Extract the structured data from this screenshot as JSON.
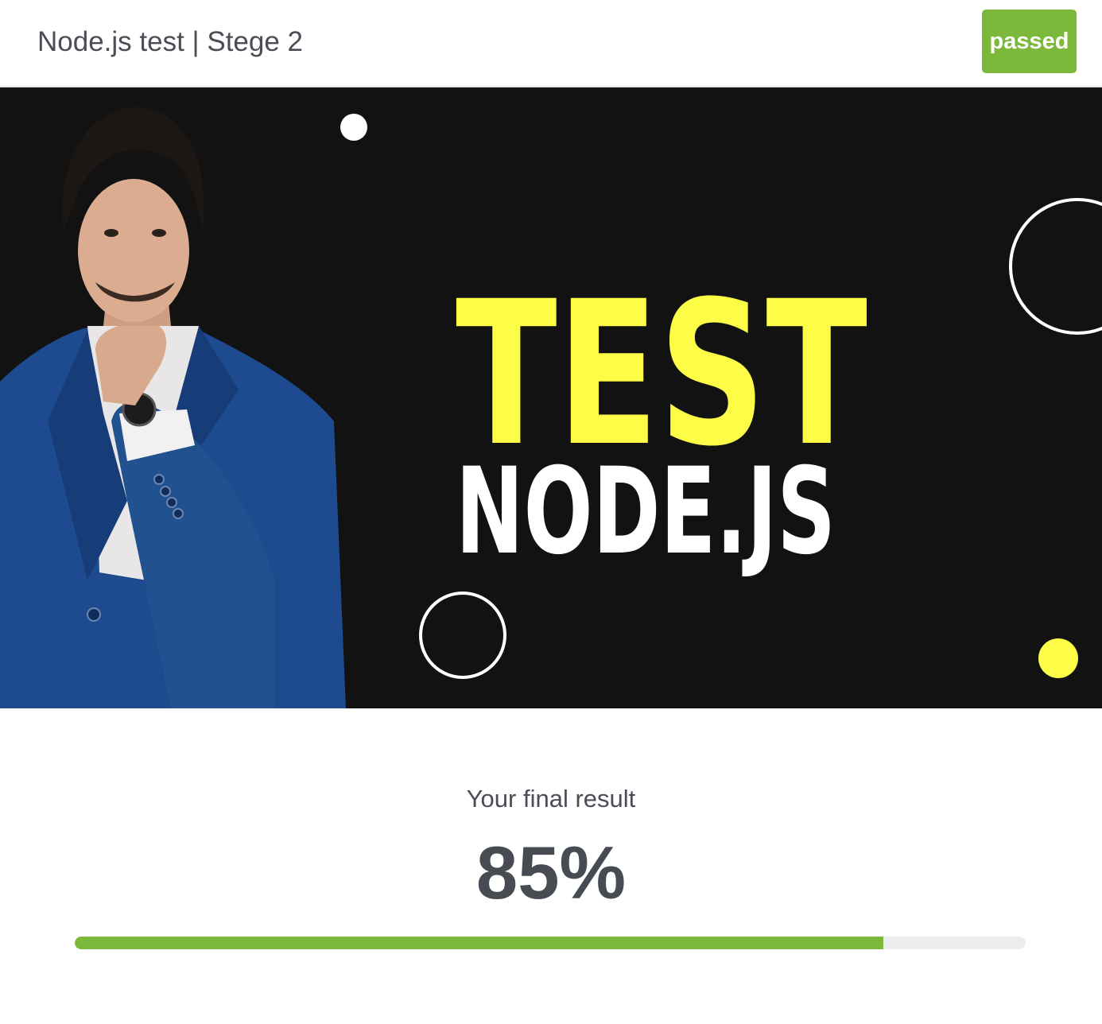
{
  "header": {
    "title": "Node.js test | Stege 2",
    "status": "passed"
  },
  "banner": {
    "headline": "TEST",
    "subheadline": "NODE.JS"
  },
  "result": {
    "label": "Your final result",
    "score_text": "85%",
    "progress": 0.85
  },
  "colors": {
    "passed": "#7cb93a",
    "progress_fill": "#7cb93a",
    "progress_track": "#ededf0",
    "banner_bg": "#121212",
    "headline": "#fdfc47",
    "subheadline": "#ffffff",
    "accent_dot": "#fdfc47",
    "suit": "#1e4b8f"
  },
  "icons": {
    "person_photo": "presenter-photo"
  }
}
